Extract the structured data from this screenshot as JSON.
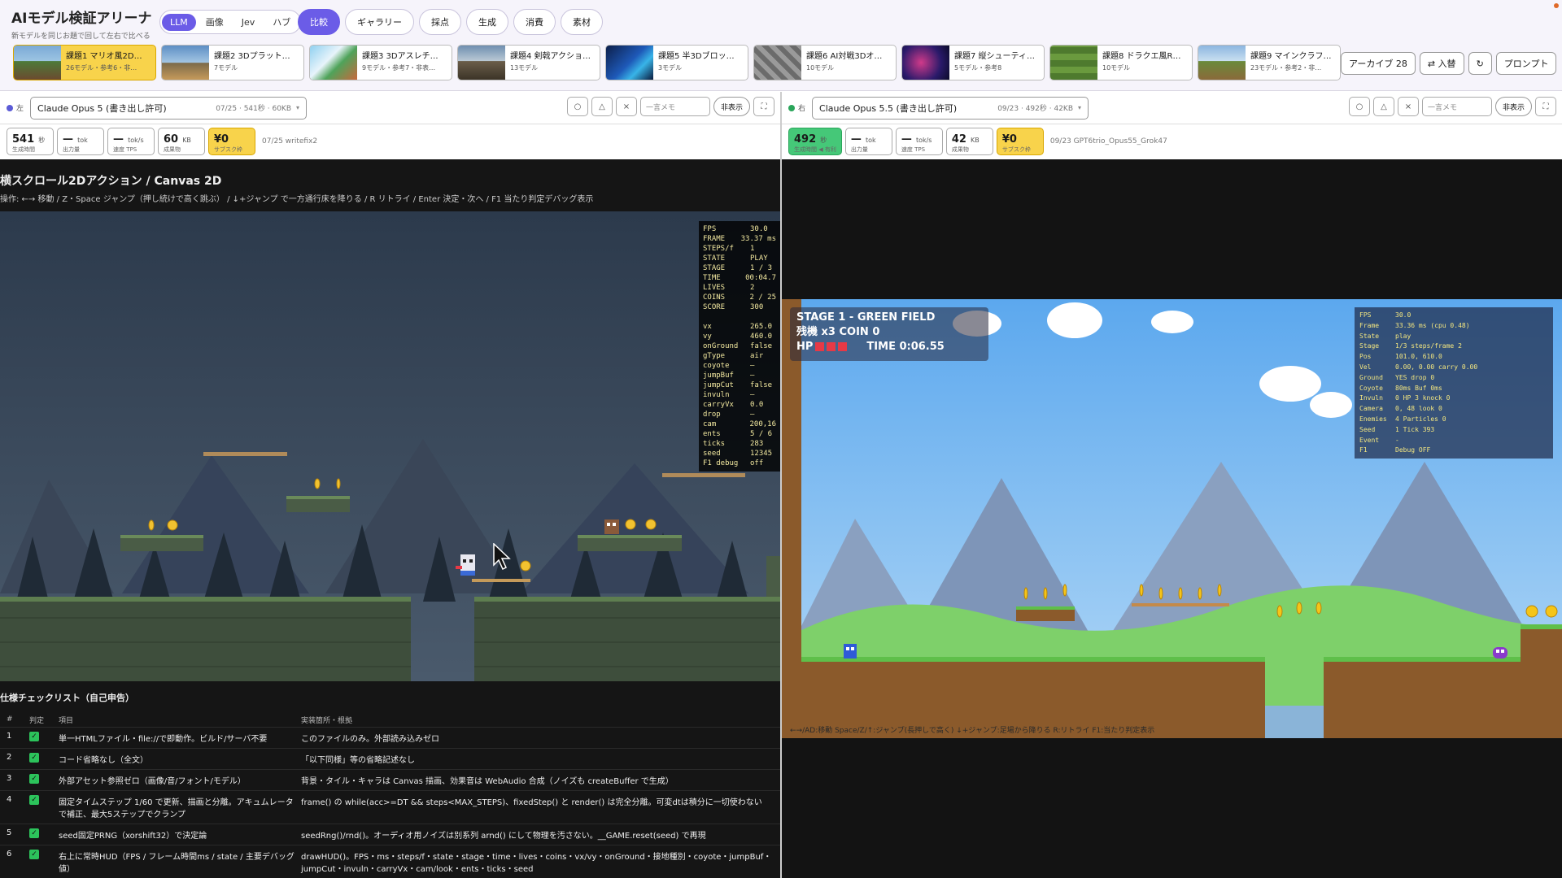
{
  "app": {
    "title": "AIモデル検証アリーナ",
    "subtitle": "新モデルを同じお題で回して左右で比べる"
  },
  "modes": [
    "LLM",
    "画像",
    "Jev",
    "ハブ"
  ],
  "nav": [
    "比較",
    "ギャラリー",
    "採点",
    "生成",
    "消費",
    "素材"
  ],
  "tasks": [
    {
      "name": "課題1 マリオ風2D…",
      "sub": "26モデル・参考6・非…"
    },
    {
      "name": "課題2 3Dプラット…",
      "sub": "7モデル"
    },
    {
      "name": "課題3 3Dアスレチ…",
      "sub": "9モデル・参考7・非表…"
    },
    {
      "name": "課題4 剣戟アクショ…",
      "sub": "13モデル"
    },
    {
      "name": "課題5 半3Dブロッ…",
      "sub": "3モデル"
    },
    {
      "name": "課題6 AI対戦3Dオ…",
      "sub": "10モデル"
    },
    {
      "name": "課題7 縦シューティ…",
      "sub": "5モデル・参考8"
    },
    {
      "name": "課題8 ドラクエ風R…",
      "sub": "10モデル"
    },
    {
      "name": "課題9 マインクラフ…",
      "sub": "23モデル・参考2・非…"
    }
  ],
  "right_controls": {
    "archive": "アーカイブ 28",
    "swap": "⇄ 入替",
    "refresh": "↻",
    "prompt": "プロンプト"
  },
  "colors": {
    "accent": "#6b5ce7",
    "highlight": "#f8d34b",
    "left_dot": "#5b5bd6",
    "right_dot": "#2aa55a"
  },
  "left": {
    "side": "左",
    "model": "Claude Opus 5 (書き出し許可)",
    "meta": "07/25 · 541秒 · 60KB",
    "memo_placeholder": "一言メモ",
    "hide": "非表示",
    "stats": [
      {
        "v": "541",
        "u": "秒",
        "l": "生成時間"
      },
      {
        "v": "—",
        "u": "tok",
        "l": "出力量"
      },
      {
        "v": "—",
        "u": "tok/s",
        "l": "速度 TPS"
      },
      {
        "v": "60",
        "u": "KB",
        "l": "成果物"
      },
      {
        "v": "¥0",
        "u": "",
        "l": "サブスク枠"
      }
    ],
    "note": "07/25 writefix2",
    "game_title": "横スクロール2Dアクション / Canvas 2D",
    "game_help": "操作: ←→ 移動 / Z・Space ジャンプ（押し続けで高く跳ぶ） / ↓+ジャンプ で一方通行床を降りる / R リトライ / Enter 決定・次へ / F1 当たり判定デバッグ表示",
    "debug": [
      [
        "FPS",
        "30.0"
      ],
      [
        "FRAME",
        "33.37 ms"
      ],
      [
        "STEPS/f",
        "1"
      ],
      [
        "STATE",
        "PLAY"
      ],
      [
        "STAGE",
        "1 / 3"
      ],
      [
        "TIME",
        "00:04.7"
      ],
      [
        "LIVES",
        "2"
      ],
      [
        "COINS",
        "2 / 25"
      ],
      [
        "SCORE",
        "300"
      ],
      [
        "",
        ""
      ],
      [
        "vx",
        "265.0"
      ],
      [
        "vy",
        "460.0"
      ],
      [
        "onGround",
        "false"
      ],
      [
        "gType",
        "air"
      ],
      [
        "coyote",
        "—"
      ],
      [
        "jumpBuf",
        "—"
      ],
      [
        "jumpCut",
        "false"
      ],
      [
        "invuln",
        "—"
      ],
      [
        "carryVx",
        "0.0"
      ],
      [
        "drop",
        "—"
      ],
      [
        "cam",
        "200,16"
      ],
      [
        "ents",
        "5 / 6"
      ],
      [
        "ticks",
        "283"
      ],
      [
        "seed",
        "12345"
      ],
      [
        "F1 debug",
        "off"
      ]
    ],
    "checklist_title": "仕様チェックリスト（自己申告）",
    "checklist_headers": [
      "#",
      "判定",
      "項目",
      "実装箇所・根拠"
    ],
    "checklist": [
      {
        "no": "1",
        "item": "単一HTMLファイル・file://で即動作。ビルド/サーバ不要",
        "basis": "このファイルのみ。外部読み込みゼロ"
      },
      {
        "no": "2",
        "item": "コード省略なし（全文）",
        "basis": "「以下同様」等の省略記述なし"
      },
      {
        "no": "3",
        "item": "外部アセット参照ゼロ（画像/音/フォント/モデル）",
        "basis": "背景・タイル・キャラは Canvas 描画、効果音は WebAudio 合成（ノイズも createBuffer で生成）"
      },
      {
        "no": "4",
        "item": "固定タイムステップ 1/60 で更新、描画と分離。アキュムレータで補正、最大5ステップでクランプ",
        "basis": "frame() の while(acc>=DT && steps<MAX_STEPS)、fixedStep() と render() は完全分離。可変dtは積分に一切使わない"
      },
      {
        "no": "5",
        "item": "seed固定PRNG（xorshift32）で決定論",
        "basis": "seedRng()/rnd()。オーディオ用ノイズは別系列 arnd() にして物理を汚さない。__GAME.reset(seed) で再現"
      },
      {
        "no": "6",
        "item": "右上に常時HUD（FPS / フレーム時間ms / state / 主要デバッグ値）",
        "basis": "drawHUD()。FPS・ms・steps/f・state・stage・time・lives・coins・vx/vy・onGround・接地種別・coyote・jumpBuf・jumpCut・invuln・carryVx・cam/look・ents・ticks・seed"
      }
    ]
  },
  "right": {
    "side": "右",
    "model": "Claude Opus 5.5 (書き出し許可)",
    "meta": "09/23 · 492秒 · 42KB",
    "memo_placeholder": "一言メモ",
    "hide": "非表示",
    "stats": [
      {
        "v": "492",
        "u": "秒",
        "l": "生成時間 ◀ 有利"
      },
      {
        "v": "—",
        "u": "tok",
        "l": "出力量"
      },
      {
        "v": "—",
        "u": "tok/s",
        "l": "速度 TPS"
      },
      {
        "v": "42",
        "u": "KB",
        "l": "成果物"
      },
      {
        "v": "¥0",
        "u": "",
        "l": "サブスク枠"
      }
    ],
    "note": "09/23 GPT6trio_Opus55_Grok47",
    "hud": {
      "stage": "STAGE 1 - GREEN FIELD",
      "lives_coins": "残機 x3   COIN 0",
      "hp": "HP",
      "time": "TIME 0:06.55"
    },
    "debug": [
      [
        "FPS",
        "30.0"
      ],
      [
        "Frame",
        "33.36 ms (cpu 0.48)"
      ],
      [
        "State",
        "play"
      ],
      [
        "Stage",
        "1/3   steps/frame 2"
      ],
      [
        "Pos",
        "101.0, 610.0"
      ],
      [
        "Vel",
        "0.00, 0.00 carry 0.00"
      ],
      [
        "Ground",
        "YES  drop 0"
      ],
      [
        "Coyote",
        "80ms  Buf 0ms"
      ],
      [
        "Invuln",
        "0  HP 3  knock 0"
      ],
      [
        "Camera",
        "0, 48  look 0"
      ],
      [
        "Enemies",
        "4  Particles 0"
      ],
      [
        "Seed",
        "1  Tick 393"
      ],
      [
        "Event",
        "-"
      ],
      [
        "F1",
        "Debug OFF"
      ]
    ],
    "help": "←→/AD:移動  Space/Z/↑:ジャンプ(長押しで高く)  ↓+ジャンプ:足場から降りる  R:リトライ  F1:当たり判定表示"
  }
}
